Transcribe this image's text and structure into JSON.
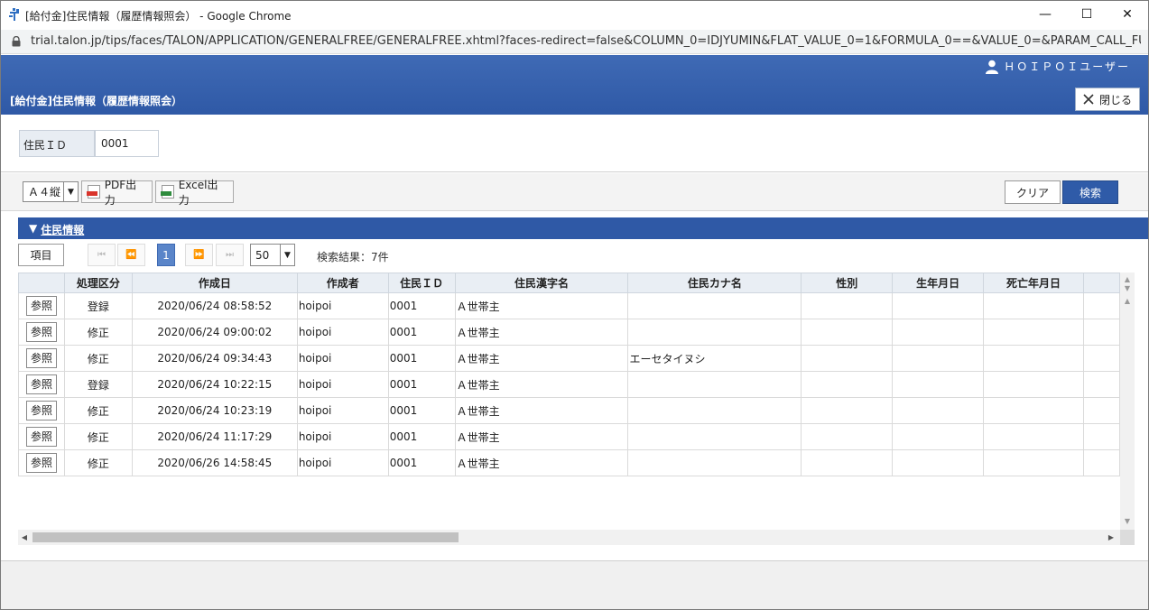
{
  "window": {
    "title": "[給付金]住民情報（履歴情報照会） - Google Chrome",
    "url": "trial.talon.jp/tips/faces/TALON/APPLICATION/GENERALFREE/GENERALFREE.xhtml?faces-redirect=false&COLUMN_0=IDJYUMIN&FLAT_VALUE_0=1&FORMULA_0==&VALUE_0=&PARAM_CALL_FUN...",
    "minimize_glyph": "—",
    "maximize_glyph": "☐",
    "close_glyph": "✕"
  },
  "header": {
    "user": "ＨＯＩＰＯＩユーザー",
    "page_title": "[給付金]住民情報（履歴情報照会）",
    "close_label": "閉じる"
  },
  "search": {
    "field_label": "住民ＩＤ",
    "field_value": "0001"
  },
  "toolbar": {
    "paper_size": "Ａ４縦",
    "pdf_label": "PDF出力",
    "excel_label": "Excel出力",
    "clear_label": "クリア",
    "search_label": "検索"
  },
  "section": {
    "title": "住民情報"
  },
  "pager": {
    "columns_label": "項目",
    "first": "⏮",
    "prev": "⏪",
    "current_page": "1",
    "next": "⏩",
    "last": "⏭",
    "per_page": "50",
    "result_text": "検索結果：7件"
  },
  "table": {
    "headers": [
      "",
      "処理区分",
      "作成日",
      "作成者",
      "住民ＩＤ",
      "住民漢字名",
      "住民カナ名",
      "性別",
      "生年月日",
      "死亡年月日",
      ""
    ],
    "ref_label": "参照",
    "rows": [
      {
        "kubun": "登録",
        "date": "2020/06/24 08:58:52",
        "author": "hoipoi",
        "id": "0001",
        "kanji": "Ａ世帯主",
        "kana": "",
        "sex": "",
        "birth": "",
        "death": ""
      },
      {
        "kubun": "修正",
        "date": "2020/06/24 09:00:02",
        "author": "hoipoi",
        "id": "0001",
        "kanji": "Ａ世帯主",
        "kana": "",
        "sex": "",
        "birth": "",
        "death": ""
      },
      {
        "kubun": "修正",
        "date": "2020/06/24 09:34:43",
        "author": "hoipoi",
        "id": "0001",
        "kanji": "Ａ世帯主",
        "kana": "エーセタイヌシ",
        "sex": "",
        "birth": "",
        "death": ""
      },
      {
        "kubun": "登録",
        "date": "2020/06/24 10:22:15",
        "author": "hoipoi",
        "id": "0001",
        "kanji": "Ａ世帯主",
        "kana": "",
        "sex": "",
        "birth": "",
        "death": ""
      },
      {
        "kubun": "修正",
        "date": "2020/06/24 10:23:19",
        "author": "hoipoi",
        "id": "0001",
        "kanji": "Ａ世帯主",
        "kana": "",
        "sex": "",
        "birth": "",
        "death": ""
      },
      {
        "kubun": "修正",
        "date": "2020/06/24 11:17:29",
        "author": "hoipoi",
        "id": "0001",
        "kanji": "Ａ世帯主",
        "kana": "",
        "sex": "",
        "birth": "",
        "death": ""
      },
      {
        "kubun": "修正",
        "date": "2020/06/26 14:58:45",
        "author": "hoipoi",
        "id": "0001",
        "kanji": "Ａ世帯主",
        "kana": "",
        "sex": "",
        "birth": "",
        "death": ""
      }
    ]
  },
  "colors": {
    "header_blue": "#2f59a6",
    "search_button": "#2f5ba8",
    "current_page": "#5a85c9"
  }
}
